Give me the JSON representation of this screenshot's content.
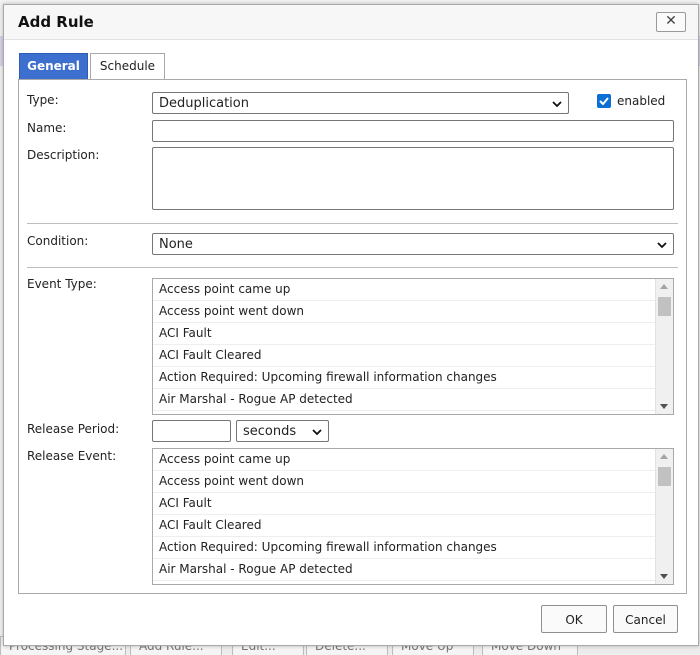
{
  "dialog": {
    "title": "Add Rule",
    "close_label": "✕"
  },
  "tabs": [
    {
      "label": "General",
      "active": true
    },
    {
      "label": "Schedule",
      "active": false
    }
  ],
  "form": {
    "type_label": "Type:",
    "type_value": "Deduplication",
    "enabled_label": "enabled",
    "enabled_checked": true,
    "name_label": "Name:",
    "name_value": "",
    "description_label": "Description:",
    "description_value": "",
    "condition_label": "Condition:",
    "condition_value": "None",
    "event_type_label": "Event Type:",
    "event_type_items": [
      "Access point came up",
      "Access point went down",
      "ACI Fault",
      "ACI Fault Cleared",
      "Action Required: Upcoming firewall information changes",
      "Air Marshal - Rogue AP detected"
    ],
    "release_period_label": "Release Period:",
    "release_period_value": "",
    "release_period_unit": "seconds",
    "release_event_label": "Release Event:",
    "release_event_items": [
      "Access point came up",
      "Access point went down",
      "ACI Fault",
      "ACI Fault Cleared",
      "Action Required: Upcoming firewall information changes",
      "Air Marshal - Rogue AP detected"
    ]
  },
  "buttons": {
    "ok": "OK",
    "cancel": "Cancel"
  },
  "background": {
    "bottom_buttons": [
      "Processing Stage...",
      "Add Rule...",
      "Edit...",
      "Delete...",
      "Move Up",
      "Move Down"
    ]
  },
  "colors": {
    "accent": "#3d6fcf",
    "checkbox": "#0b6fd6"
  }
}
